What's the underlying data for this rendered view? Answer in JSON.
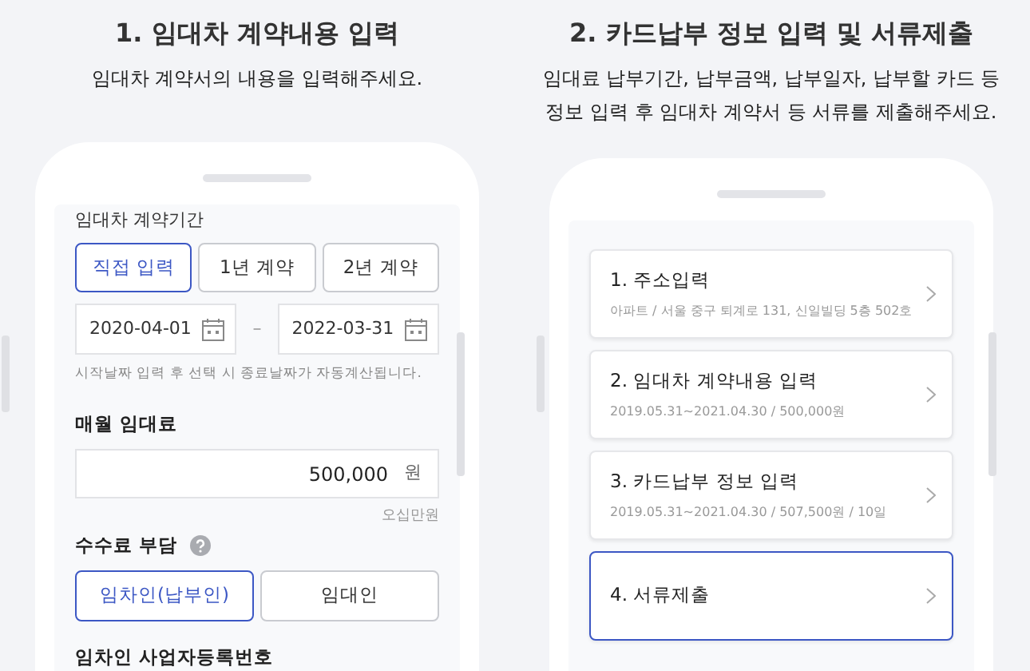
{
  "left": {
    "heading": "1. 임대차 계약내용 입력",
    "description_lines": [
      "임대차 계약서의 내용을 입력해주세요."
    ],
    "form": {
      "period_label": "임대차 계약기간",
      "period_tabs": [
        {
          "label": "직접 입력",
          "selected": true
        },
        {
          "label": "1년 계약",
          "selected": false
        },
        {
          "label": "2년 계약",
          "selected": false
        }
      ],
      "start_date": "2020-04-01",
      "date_separator": "–",
      "end_date": "2022-03-31",
      "date_hint": "시작날짜 입력 후 선택 시 종료날짜가 자동계산됩니다.",
      "rent_label": "매월 임대료",
      "rent_value": "500,000",
      "rent_unit": "원",
      "rent_in_words": "오십만원",
      "fee_label": "수수료 부담",
      "fee_options": [
        {
          "label": "임차인(납부인)",
          "selected": true
        },
        {
          "label": "임대인",
          "selected": false
        }
      ],
      "next_label": "임차인 사업자등록번호"
    }
  },
  "right": {
    "heading": "2. 카드납부 정보 입력 및 서류제출",
    "description_lines": [
      "임대료 납부기간, 납부금액, 납부일자, 납부할 카드 등",
      "정보 입력 후 임대차 계약서 등 서류를 제출해주세요."
    ],
    "steps": [
      {
        "title": "1. 주소입력",
        "detail": "아파트 / 서울 중구 퇴계로 131, 신일빌딩 5층 502호",
        "selected": false
      },
      {
        "title": "2. 임대차 계약내용 입력",
        "detail": "2019.05.31~2021.04.30 / 500,000원",
        "selected": false
      },
      {
        "title": "3. 카드납부 정보 입력",
        "detail": "2019.05.31~2021.04.30 / 507,500원 / 10일",
        "selected": false
      },
      {
        "title": "4. 서류제출",
        "selected": true
      }
    ]
  }
}
